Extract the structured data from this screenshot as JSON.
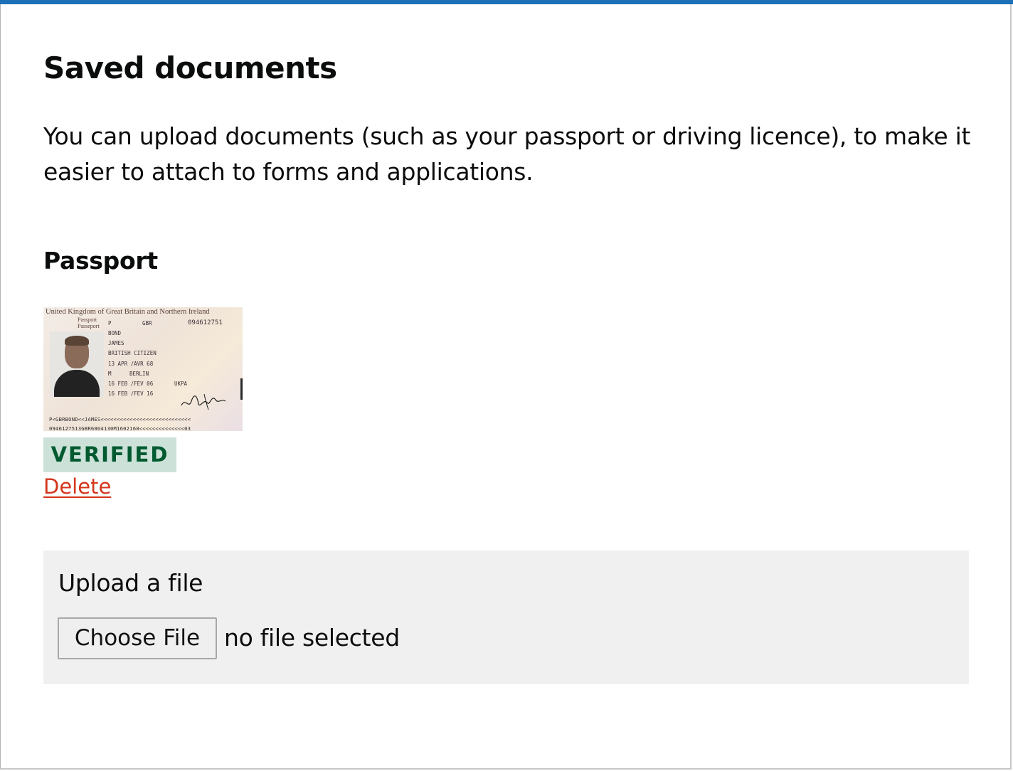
{
  "page": {
    "title": "Saved documents",
    "intro": "You can upload documents (such as your passport or driving licence), to make it easier to attach to forms and applications.",
    "accent_color": "#1d70b8"
  },
  "documents": [
    {
      "heading": "Passport",
      "thumbnail": {
        "issuer": "United Kingdom of Great Britain and Northern Ireland",
        "doc_label_1": "Passport",
        "doc_label_2": "Passeport",
        "type": "P",
        "code": "GBR",
        "number": "094612751",
        "surname": "BOND",
        "given_names": "JAMES",
        "nationality": "BRITISH CITIZEN",
        "date_of_birth": "13 APR /AVR 68",
        "sex": "M",
        "place_of_birth": "BERLIN",
        "date_of_issue": "16 FEB /FEV 06",
        "authority": "UKPA",
        "date_of_expiry": "16 FEB /FEV 16",
        "mrz_line_1": "P<GBRBOND<<JAMES<<<<<<<<<<<<<<<<<<<<<<<<<<<<",
        "mrz_line_2": "0946127513GBR6804130M1602168<<<<<<<<<<<<<<03"
      },
      "status": "VERIFIED",
      "status_colors": {
        "background": "#cce2d8",
        "text": "#005a30"
      },
      "delete_label": "Delete",
      "delete_color": "#d4351c"
    }
  ],
  "upload": {
    "label": "Upload a file",
    "button_label": "Choose File",
    "status": "no file selected"
  }
}
